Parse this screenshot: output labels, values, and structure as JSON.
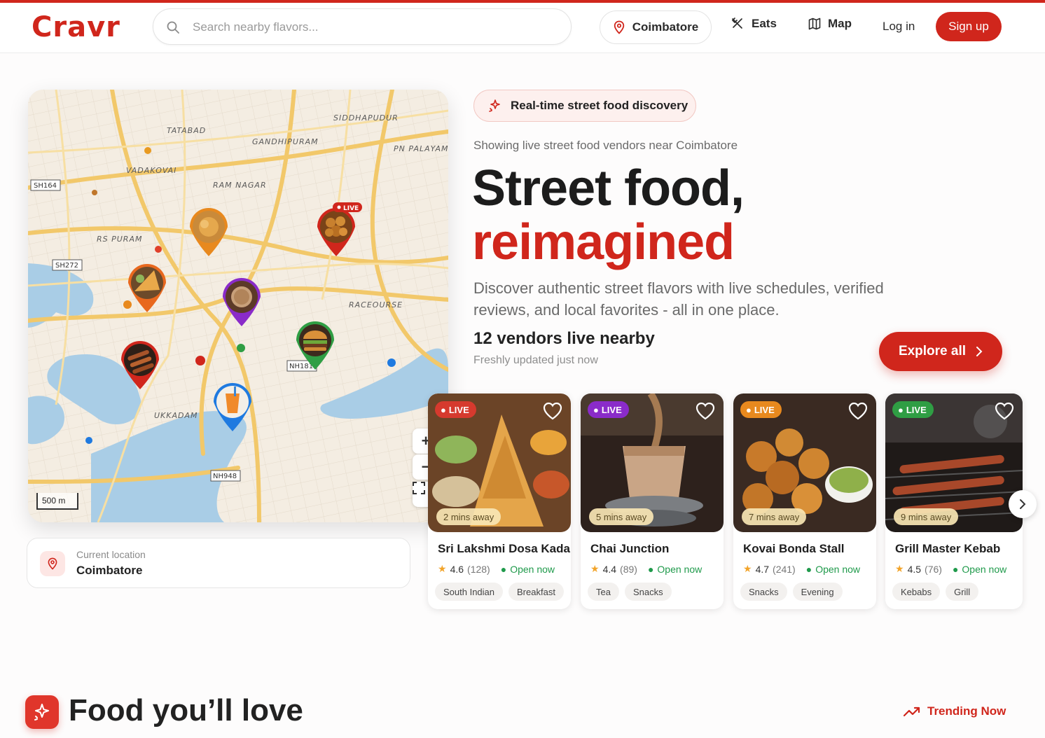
{
  "header": {
    "logo": "Cravr",
    "search_placeholder": "Search nearby flavors...",
    "location": "Coimbatore",
    "nav": [
      {
        "label": "Eats",
        "icon": "utensils-icon"
      },
      {
        "label": "Map",
        "icon": "map-icon"
      }
    ],
    "login": "Log in",
    "signup": "Sign up"
  },
  "map": {
    "areas": [
      "SIDDHAPUDUR",
      "TATABAD",
      "GANDHIPURAM",
      "PN PALAYAM",
      "VADAKOVAI",
      "RAM NAGAR",
      "RS PURAM",
      "RACEOURSE",
      "UKKADAM"
    ],
    "roads": [
      "SH164",
      "SH272",
      "NH181",
      "NH948"
    ],
    "live_badge": "LIVE",
    "scale": "500 m",
    "zoom_in": "+",
    "zoom_out": "−",
    "controls": [
      "plus-icon",
      "minus-icon",
      "fullscreen-icon"
    ]
  },
  "current_location": {
    "label": "Current location",
    "value": "Coimbatore"
  },
  "hero": {
    "badge": "Real-time street food discovery",
    "showing": "Showing live street food vendors near Coimbatore",
    "title_line1": "Street food,",
    "title_line2": "reimagined",
    "description": "Discover authentic street flavors with live schedules, verified reviews, and local favorites - all in one place.",
    "vendors_live": "12 vendors live nearby",
    "freshness": "Freshly updated just now",
    "explore": "Explore all"
  },
  "vendors": [
    {
      "live": "LIVE",
      "live_color": "#d63a2e",
      "mins": "2 mins away",
      "name": "Sri Lakshmi Dosa Kadai",
      "rating": "4.6",
      "reviews": "(128)",
      "status": "Open now",
      "tags": [
        "South Indian",
        "Breakfast"
      ]
    },
    {
      "live": "LIVE",
      "live_color": "#8a2bc9",
      "mins": "5 mins away",
      "name": "Chai Junction",
      "rating": "4.4",
      "reviews": "(89)",
      "status": "Open now",
      "tags": [
        "Tea",
        "Snacks"
      ]
    },
    {
      "live": "LIVE",
      "live_color": "#e8891e",
      "mins": "7 mins away",
      "name": "Kovai Bonda Stall",
      "rating": "4.7",
      "reviews": "(241)",
      "status": "Open now",
      "tags": [
        "Snacks",
        "Evening"
      ]
    },
    {
      "live": "LIVE",
      "live_color": "#2f9e44",
      "mins": "9 mins away",
      "name": "Grill Master Kebab",
      "rating": "4.5",
      "reviews": "(76)",
      "status": "Open now",
      "tags": [
        "Kebabs",
        "Grill"
      ]
    }
  ],
  "section": {
    "title": "Food you’ll love",
    "trending": "Trending Now"
  },
  "colors": {
    "brand": "#d0261c",
    "open": "#1f9a4b",
    "star": "#f2a42a"
  }
}
